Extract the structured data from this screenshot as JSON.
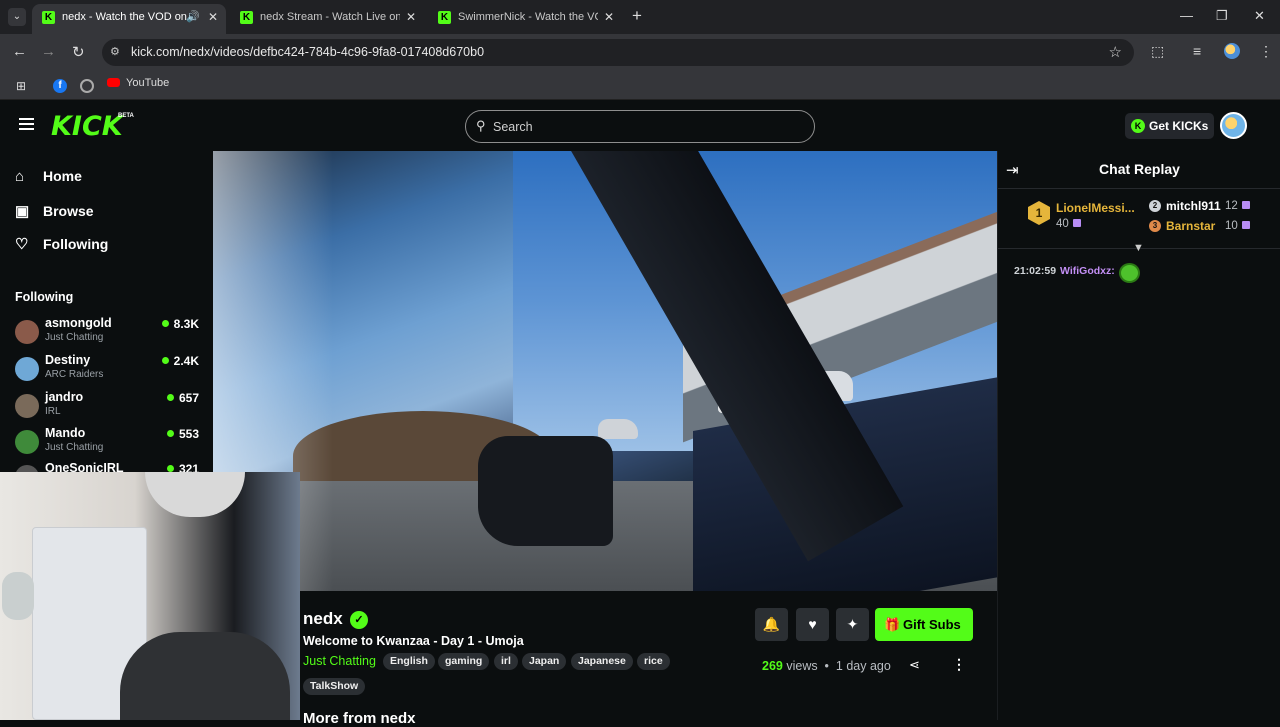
{
  "browser": {
    "tabs": [
      {
        "title": "nedx - Watch the VOD on K",
        "active": true
      },
      {
        "title": "nedx Stream - Watch Live on Ki",
        "active": false
      },
      {
        "title": "SwimmerNick - Watch the VOD",
        "active": false
      }
    ],
    "url": "kick.com/nedx/videos/defbc424-784b-4c96-9fa8-017408d670b0",
    "bookmarks": [
      {
        "label": "YouTube"
      }
    ]
  },
  "header": {
    "logo": "KICK",
    "beta": "BETA",
    "search_placeholder": "Search",
    "get_kicks": "Get KICKs"
  },
  "sidebar": {
    "nav": [
      {
        "label": "Home",
        "icon": "home-icon"
      },
      {
        "label": "Browse",
        "icon": "browse-icon"
      },
      {
        "label": "Following",
        "icon": "heart-icon"
      }
    ],
    "following_heading": "Following",
    "following": [
      {
        "name": "asmongold",
        "category": "Just Chatting",
        "viewers": "8.3K"
      },
      {
        "name": "Destiny",
        "category": "ARC Raiders",
        "viewers": "2.4K"
      },
      {
        "name": "jandro",
        "category": "IRL",
        "viewers": "657"
      },
      {
        "name": "Mando",
        "category": "Just Chatting",
        "viewers": "553"
      },
      {
        "name": "OneSonicIRL",
        "category": "",
        "viewers": "321"
      }
    ]
  },
  "video_info": {
    "channel": "nedx",
    "title": "Welcome to Kwanzaa - Day 1 - Umoja",
    "category": "Just Chatting",
    "tags": [
      "English",
      "gaming",
      "irl",
      "Japan",
      "Japanese",
      "rice",
      "TalkShow"
    ],
    "views_count": "269",
    "views_label": "views",
    "age": "1 day ago",
    "gift_subs": "Gift Subs",
    "more_from": "More from nedx"
  },
  "chat": {
    "title": "Chat Replay",
    "top_gifters": [
      {
        "rank": "1",
        "name": "LionelMessi...",
        "count": "40"
      },
      {
        "rank": "2",
        "name": "mitchl911",
        "count": "12"
      },
      {
        "rank": "3",
        "name": "Barnstar",
        "count": "10"
      }
    ],
    "messages": [
      {
        "time": "21:02:59",
        "user": "WifiGodxz:",
        "emote": "green-emote"
      }
    ]
  },
  "colors": {
    "kick_green": "#53fc18",
    "background": "#0b0e0f",
    "gold": "#e5b53b",
    "chat_user": "#c38ff5"
  }
}
